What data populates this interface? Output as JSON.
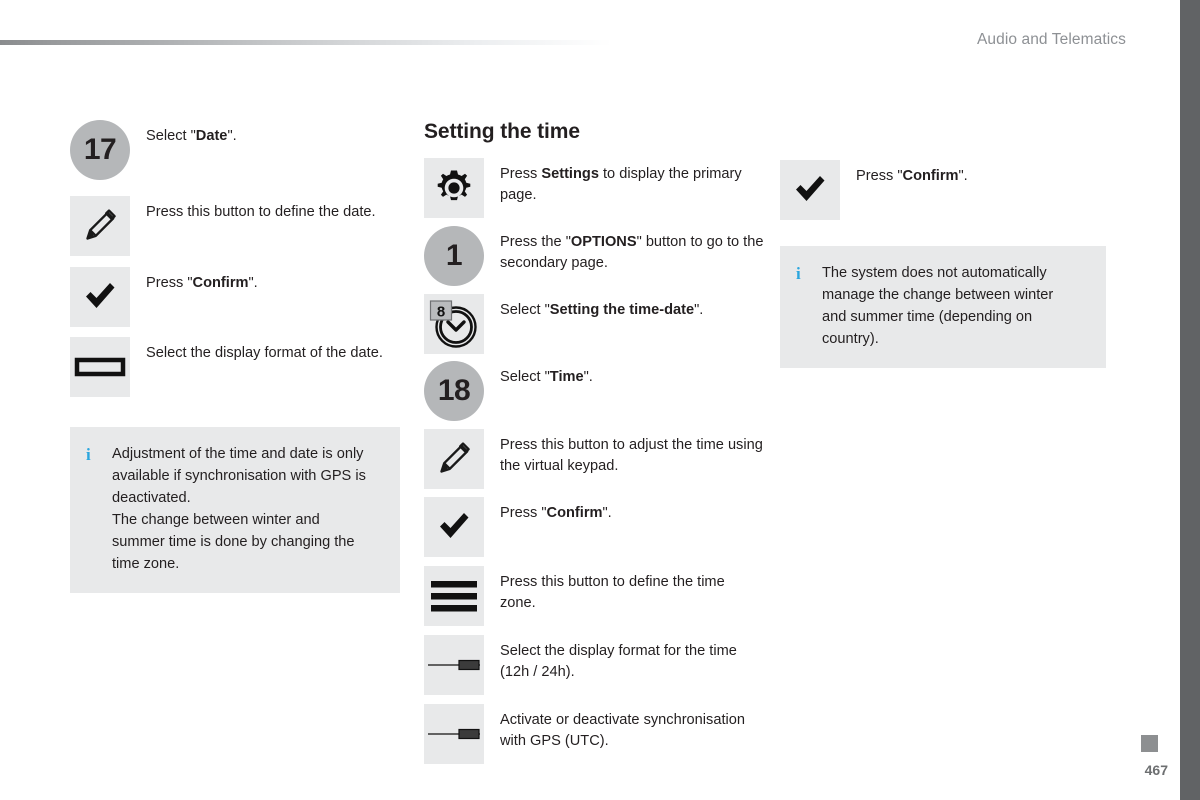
{
  "header": {
    "title": "Audio and Telematics"
  },
  "footer": {
    "page_number": "467",
    "chapter_mark": "square-marker"
  },
  "colors": {
    "accent_info": "#2ba6de",
    "icon_box": "#e8e9ea",
    "icon_circle": "#b5b7b9",
    "header_text": "#8d9094",
    "edge_strip": "#616365"
  },
  "columns": {
    "left": {
      "steps": [
        {
          "icon": "circle-number-17",
          "number": "17",
          "text_parts": [
            {
              "t": "Select \"",
              "b": false
            },
            {
              "t": "Date",
              "b": true
            },
            {
              "t": "\".",
              "b": false
            }
          ]
        },
        {
          "icon": "pencil-icon",
          "text_parts": [
            {
              "t": "Press this button to define the date.",
              "b": false
            }
          ]
        },
        {
          "icon": "checkmark-icon",
          "text_parts": [
            {
              "t": "Press \"",
              "b": false
            },
            {
              "t": "Confirm",
              "b": true
            },
            {
              "t": "\".",
              "b": false
            }
          ]
        },
        {
          "icon": "rectangle-outline-icon",
          "text_parts": [
            {
              "t": "Select the display format of the date.",
              "b": false
            }
          ]
        }
      ],
      "note": {
        "marker": "info-i",
        "lines": [
          "Adjustment of the time and date is only",
          "available if synchronisation with GPS is",
          "deactivated.",
          "The change between winter and",
          "summer time is done by changing the",
          "time zone."
        ]
      }
    },
    "middle": {
      "title": "Setting the time",
      "steps": [
        {
          "icon": "gear-icon",
          "text_parts": [
            {
              "t": "Press ",
              "b": false
            },
            {
              "t": "Settings",
              "b": true
            },
            {
              "t": " to display the primary page.",
              "b": false
            }
          ]
        },
        {
          "icon": "circle-number-1",
          "number": "1",
          "text_parts": [
            {
              "t": "Press the \"",
              "b": false
            },
            {
              "t": "OPTIONS",
              "b": true
            },
            {
              "t": "\" button to go to the secondary page.",
              "b": false
            }
          ]
        },
        {
          "icon": "clock-calendar-icon",
          "badge": "8",
          "text_parts": [
            {
              "t": "Select \"",
              "b": false
            },
            {
              "t": "Setting the time-date",
              "b": true
            },
            {
              "t": "\".",
              "b": false
            }
          ]
        },
        {
          "icon": "circle-number-18",
          "number": "18",
          "text_parts": [
            {
              "t": "Select \"",
              "b": false
            },
            {
              "t": "Time",
              "b": true
            },
            {
              "t": "\".",
              "b": false
            }
          ]
        },
        {
          "icon": "pencil-icon",
          "text_parts": [
            {
              "t": "Press this button to adjust the time using the virtual keypad.",
              "b": false
            }
          ]
        },
        {
          "icon": "checkmark-icon",
          "text_parts": [
            {
              "t": "Press \"",
              "b": false
            },
            {
              "t": "Confirm",
              "b": true
            },
            {
              "t": "\".",
              "b": false
            }
          ]
        },
        {
          "icon": "hamburger-list-icon",
          "text_parts": [
            {
              "t": "Press this button to define the time zone.",
              "b": false
            }
          ]
        },
        {
          "icon": "slider-icon",
          "text_parts": [
            {
              "t": "Select the display format for the time (12h / 24h).",
              "b": false
            }
          ]
        },
        {
          "icon": "slider-icon",
          "text_parts": [
            {
              "t": "Activate or deactivate synchronisation with GPS (UTC).",
              "b": false
            }
          ]
        }
      ]
    },
    "right": {
      "steps": [
        {
          "icon": "checkmark-icon",
          "text_parts": [
            {
              "t": "Press \"",
              "b": false
            },
            {
              "t": "Confirm",
              "b": true
            },
            {
              "t": "\".",
              "b": false
            }
          ]
        }
      ],
      "note": {
        "marker": "info-i",
        "lines": [
          "The system does not automatically",
          "manage the change between winter",
          "and summer time (depending on",
          "country)."
        ]
      }
    }
  }
}
